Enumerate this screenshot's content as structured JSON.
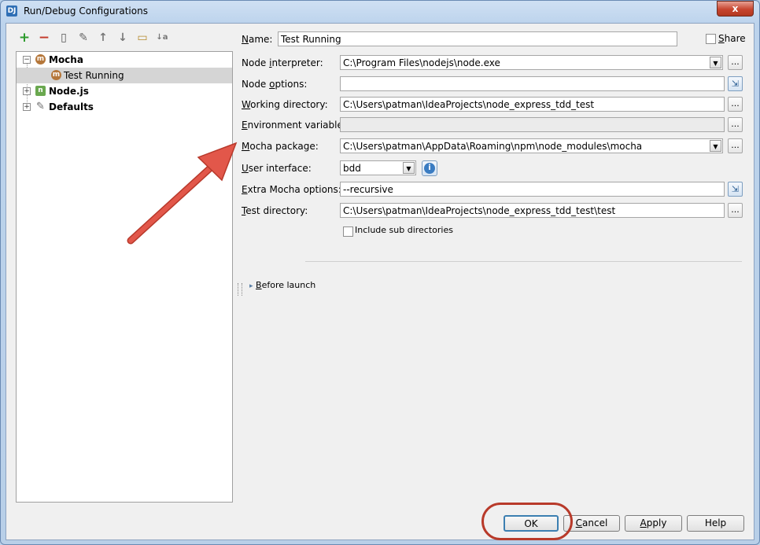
{
  "window": {
    "title": "Run/Debug Configurations",
    "app_icon": "DJ",
    "close_glyph": "x"
  },
  "toolbar": {
    "icons": [
      "add-icon",
      "remove-icon",
      "copy-icon",
      "wrench-icon",
      "move-up-icon",
      "move-down-icon",
      "folder-icon",
      "sort-alpha-icon"
    ],
    "glyphs": [
      "+",
      "−",
      "▯",
      "✎",
      "↑",
      "↓",
      "▭",
      "↓a"
    ]
  },
  "tree": {
    "items": [
      {
        "label": "Mocha",
        "icon": "mocha-icon",
        "glyph": "m",
        "bold": true,
        "expander": "−"
      },
      {
        "label": "Test Running",
        "icon": "mocha-icon",
        "glyph": "m",
        "bold": false,
        "selected": true
      },
      {
        "label": "Node.js",
        "icon": "nodejs-icon",
        "glyph": "n",
        "bold": true,
        "expander": "+"
      },
      {
        "label": "Defaults",
        "icon": "wrench-icon",
        "glyph": "✎",
        "bold": true,
        "expander": "+"
      }
    ]
  },
  "form": {
    "name": {
      "label_ul": "N",
      "label_rest": "ame:",
      "value": "Test Running"
    },
    "share": {
      "label_ul": "S",
      "label_rest": "hare",
      "checked": false
    },
    "node_interpreter": {
      "label_pre": "Node ",
      "label_ul": "i",
      "label_rest": "nterpreter:",
      "value": "C:\\Program Files\\nodejs\\node.exe"
    },
    "node_options": {
      "label_pre": "Node ",
      "label_ul": "o",
      "label_rest": "ptions:",
      "value": ""
    },
    "working_directory": {
      "label_ul": "W",
      "label_rest": "orking directory:",
      "value": "C:\\Users\\patman\\IdeaProjects\\node_express_tdd_test"
    },
    "environment_variables": {
      "label_ul": "E",
      "label_rest": "nvironment variables:",
      "value": ""
    },
    "mocha_package": {
      "label_ul": "M",
      "label_rest": "ocha package:",
      "value": "C:\\Users\\patman\\AppData\\Roaming\\npm\\node_modules\\mocha"
    },
    "user_interface": {
      "label_ul": "U",
      "label_rest": "ser interface:",
      "value": "bdd"
    },
    "extra_mocha_options": {
      "label_ul": "E",
      "label_rest": "xtra Mocha options:",
      "value": "--recursive"
    },
    "test_directory": {
      "label_ul": "T",
      "label_rest": "est directory:",
      "value": "C:\\Users\\patman\\IdeaProjects\\node_express_tdd_test\\test"
    },
    "include_sub_directories": {
      "label": "Include sub directories",
      "checked": false
    }
  },
  "before_launch": {
    "label_ul": "B",
    "label_rest": "efore launch",
    "chevron": "▸"
  },
  "buttons": {
    "ok": "OK",
    "cancel_ul": "C",
    "cancel_rest": "ancel",
    "apply_ul": "A",
    "apply_rest": "pply",
    "help": "Help"
  },
  "glyphs": {
    "ellipsis": "...",
    "dropdown": "▼",
    "expand": "⇲",
    "info": "i"
  },
  "colors": {
    "annotation_red": "#d9473a",
    "selection": "#d5d5d5"
  }
}
